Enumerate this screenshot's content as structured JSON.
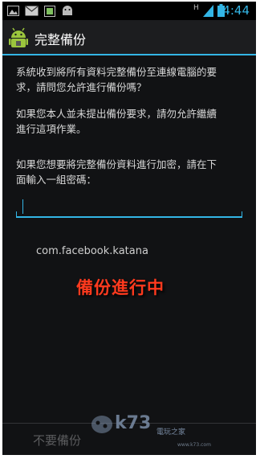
{
  "statusbar": {
    "time": "4:44",
    "network_label": "H",
    "icons": [
      "image-icon",
      "mail-icon",
      "screenshot-icon",
      "android-icon",
      "signal-icon",
      "battery-icon"
    ]
  },
  "actionbar": {
    "title": "完整備份",
    "icon": "android-backup-icon"
  },
  "message": {
    "line1": "系統收到將所有資料完整備份至連線電腦的要",
    "line2": "求，請問您允許進行備份嗎？",
    "line3": "如果您本人並未提出備份要求，請勿允許繼續",
    "line4": "進行這項作業。",
    "line5": "如果您想要將完整備份資料進行加密，請在下",
    "line6": "面輸入一組密碼："
  },
  "password": {
    "value": ""
  },
  "package": "com.facebook.katana",
  "overlay_text": "備份進行中",
  "buttons": {
    "deny": "不要備份"
  },
  "watermark": {
    "logo": "k73",
    "cn": "電玩之家",
    "sub": "www.k73.com"
  },
  "colors": {
    "accent": "#33b5e5",
    "overlay": "#ff3a1e",
    "background": "#111214"
  }
}
